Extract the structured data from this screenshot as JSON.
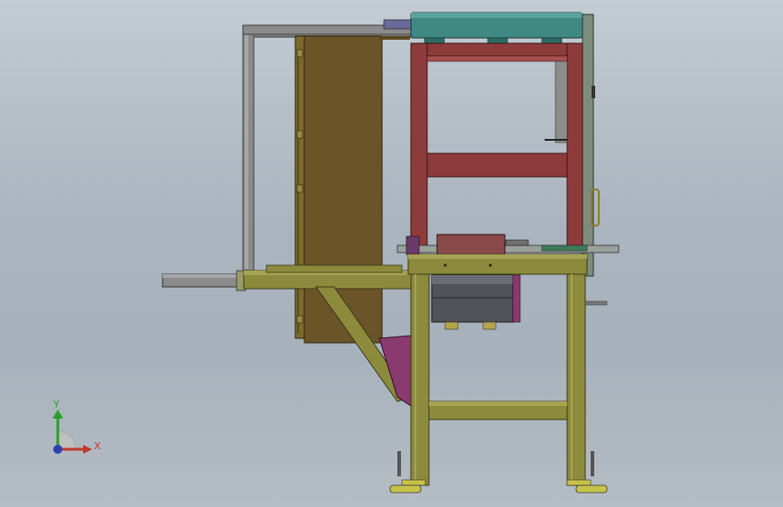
{
  "viewport": {
    "background_top": "#c3cbd3",
    "background_bottom": "#a8b2bc"
  },
  "colors": {
    "frame_olive": "#8c8a3c",
    "frame_olive_dark": "#5e5d22",
    "hopper_brown": "#6b5428",
    "inner_frame_red": "#8e3b3b",
    "top_teal": "#3f8884",
    "gray_rail": "#8c8c8c",
    "motor_dark": "#4f5258",
    "bracket_purple": "#8a3a6e",
    "foot_yellow": "#c7c24a"
  },
  "triad": {
    "y_label": "Y",
    "x_label": "X",
    "y_color": "#2aa02a",
    "x_color": "#c0392b",
    "z_color": "#2a3fb0"
  }
}
